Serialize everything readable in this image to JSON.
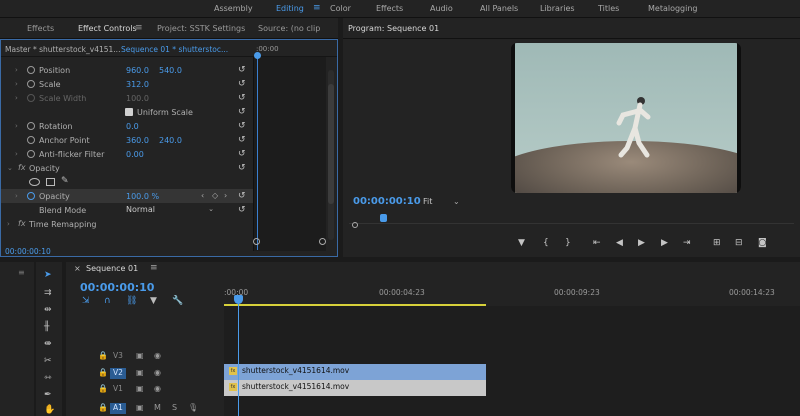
{
  "workspaces": [
    "Assembly",
    "Editing",
    "Color",
    "Effects",
    "Audio",
    "All Panels",
    "Libraries",
    "Titles",
    "Metalogging"
  ],
  "active_workspace": "Editing",
  "panel_tabs": {
    "effects": "Effects",
    "effect_controls": "Effect Controls",
    "project": "Project: SSTK Settings",
    "source": "Source: (no clip",
    "program": "Program: Sequence 01"
  },
  "effect_controls": {
    "master": "Master * shutterstock_v4151...",
    "sequence": "Sequence 01 * shutterstoc...",
    "top_timecode": ":00:00",
    "rows": {
      "position": {
        "label": "Position",
        "v1": "960.0",
        "v2": "540.0"
      },
      "scale": {
        "label": "Scale",
        "v1": "312.0"
      },
      "scale_width": {
        "label": "Scale Width",
        "v1": "100.0"
      },
      "uniform_scale": "Uniform Scale",
      "rotation": {
        "label": "Rotation",
        "v1": "0.0"
      },
      "anchor_point": {
        "label": "Anchor Point",
        "v1": "360.0",
        "v2": "240.0"
      },
      "anti_flicker": {
        "label": "Anti-flicker Filter",
        "v1": "0.00"
      },
      "opacity_group": "Opacity",
      "opacity": {
        "label": "Opacity",
        "v1": "100.0 %"
      },
      "blend_mode": {
        "label": "Blend Mode",
        "value": "Normal"
      },
      "time_remapping": "Time Remapping"
    },
    "timecode": "00:00:00:10"
  },
  "program": {
    "timecode": "00:00:00:10",
    "fit": "Fit"
  },
  "timeline": {
    "tab": "Sequence 01",
    "timecode": "00:00:00:10",
    "ruler": [
      ":00:00",
      "00:00:04:23",
      "00:00:09:23",
      "00:00:14:23"
    ],
    "tracks": [
      {
        "name": "V3",
        "active": false
      },
      {
        "name": "V2",
        "active": true
      },
      {
        "name": "V1",
        "active": false
      },
      {
        "name": "A1",
        "active": true
      }
    ],
    "clip_v2": "shutterstock_v4151614.mov",
    "clip_v1": "shutterstock_v4151614.mov",
    "a1_m": "M",
    "a1_s": "S"
  },
  "colors": {
    "accent": "#4a9bea",
    "clip_v2": "#7da3d6",
    "clip_v1": "#c8c8c8",
    "inout": "#d6d03a"
  }
}
